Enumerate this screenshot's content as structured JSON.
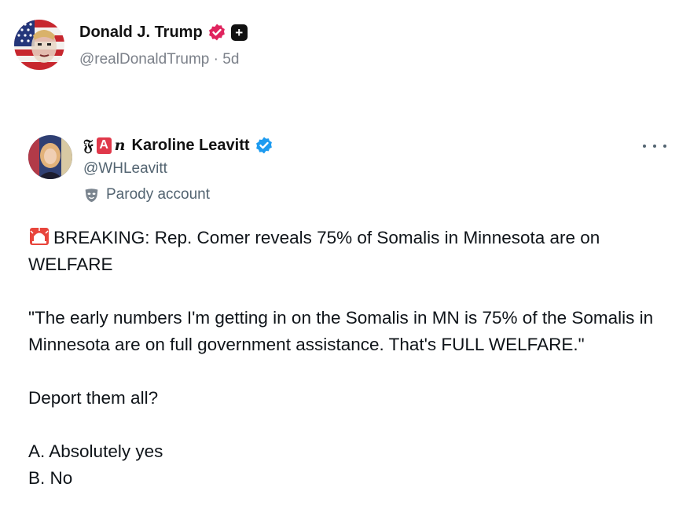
{
  "outer_post": {
    "display_name": "Donald J. Trump",
    "handle_line": "@realDonaldTrump · 5d",
    "verified_badge_color": "#e0245e",
    "badge_plus_symbol": "+"
  },
  "quoted_post": {
    "name_prefix_t": "𝔉",
    "name_prefix_a": "A",
    "name_prefix_n": "n",
    "display_name": "Karoline Leavitt",
    "handle": "@WHLeavitt",
    "parody_label": "Parody account",
    "verified_badge_color": "#1d9bf0",
    "more_icon": "more-horizontal-icon",
    "text": {
      "line1": "BREAKING: Rep. Comer reveals 75% of Somalis in Minnesota are on WELFARE",
      "para2": "\"The early numbers I'm getting in on the Somalis in MN is 75% of the Somalis in Minnesota are on full government assistance. That's FULL WELFARE.\"",
      "para3": "Deport them all?",
      "option_a": "A. Absolutely yes",
      "option_b": "B. No"
    }
  }
}
